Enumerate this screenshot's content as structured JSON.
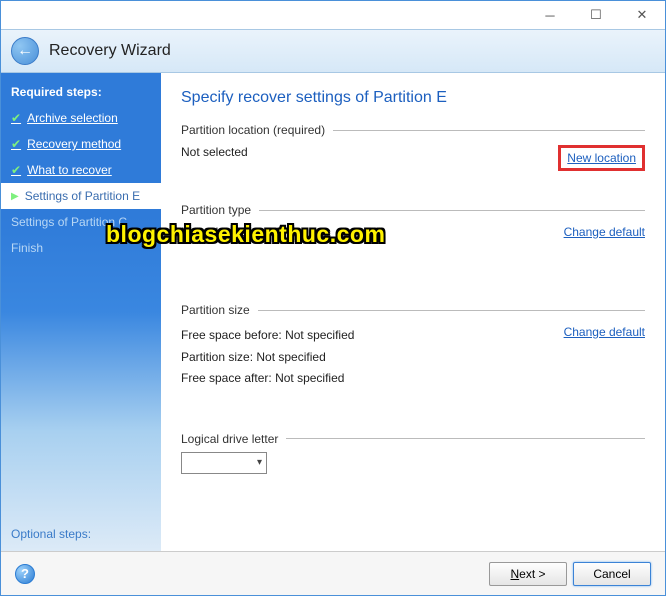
{
  "window": {
    "title": "Recovery Wizard"
  },
  "sidebar": {
    "heading": "Required steps:",
    "steps": [
      {
        "label": "Archive selection"
      },
      {
        "label": "Recovery method"
      },
      {
        "label": "What to recover"
      },
      {
        "label": "Settings of Partition E"
      },
      {
        "label": "Settings of Partition C"
      },
      {
        "label": "Finish"
      }
    ],
    "optional": "Optional steps:"
  },
  "main": {
    "title": "Specify recover settings of Partition E",
    "sections": {
      "location": {
        "heading": "Partition location (required)",
        "value": "Not selected",
        "action": "New location"
      },
      "type": {
        "heading": "Partition type",
        "value": "Not selected",
        "action": "Change default"
      },
      "size": {
        "heading": "Partition size",
        "before_label": "Free space before:",
        "before_value": "Not specified",
        "size_label": "Partition size:",
        "size_value": "Not specified",
        "after_label": "Free space after:",
        "after_value": "Not specified",
        "action": "Change default"
      },
      "drive": {
        "heading": "Logical drive letter"
      }
    }
  },
  "footer": {
    "next": "Next >",
    "cancel": "Cancel"
  },
  "watermark": "blogchiasekienthuc.com"
}
